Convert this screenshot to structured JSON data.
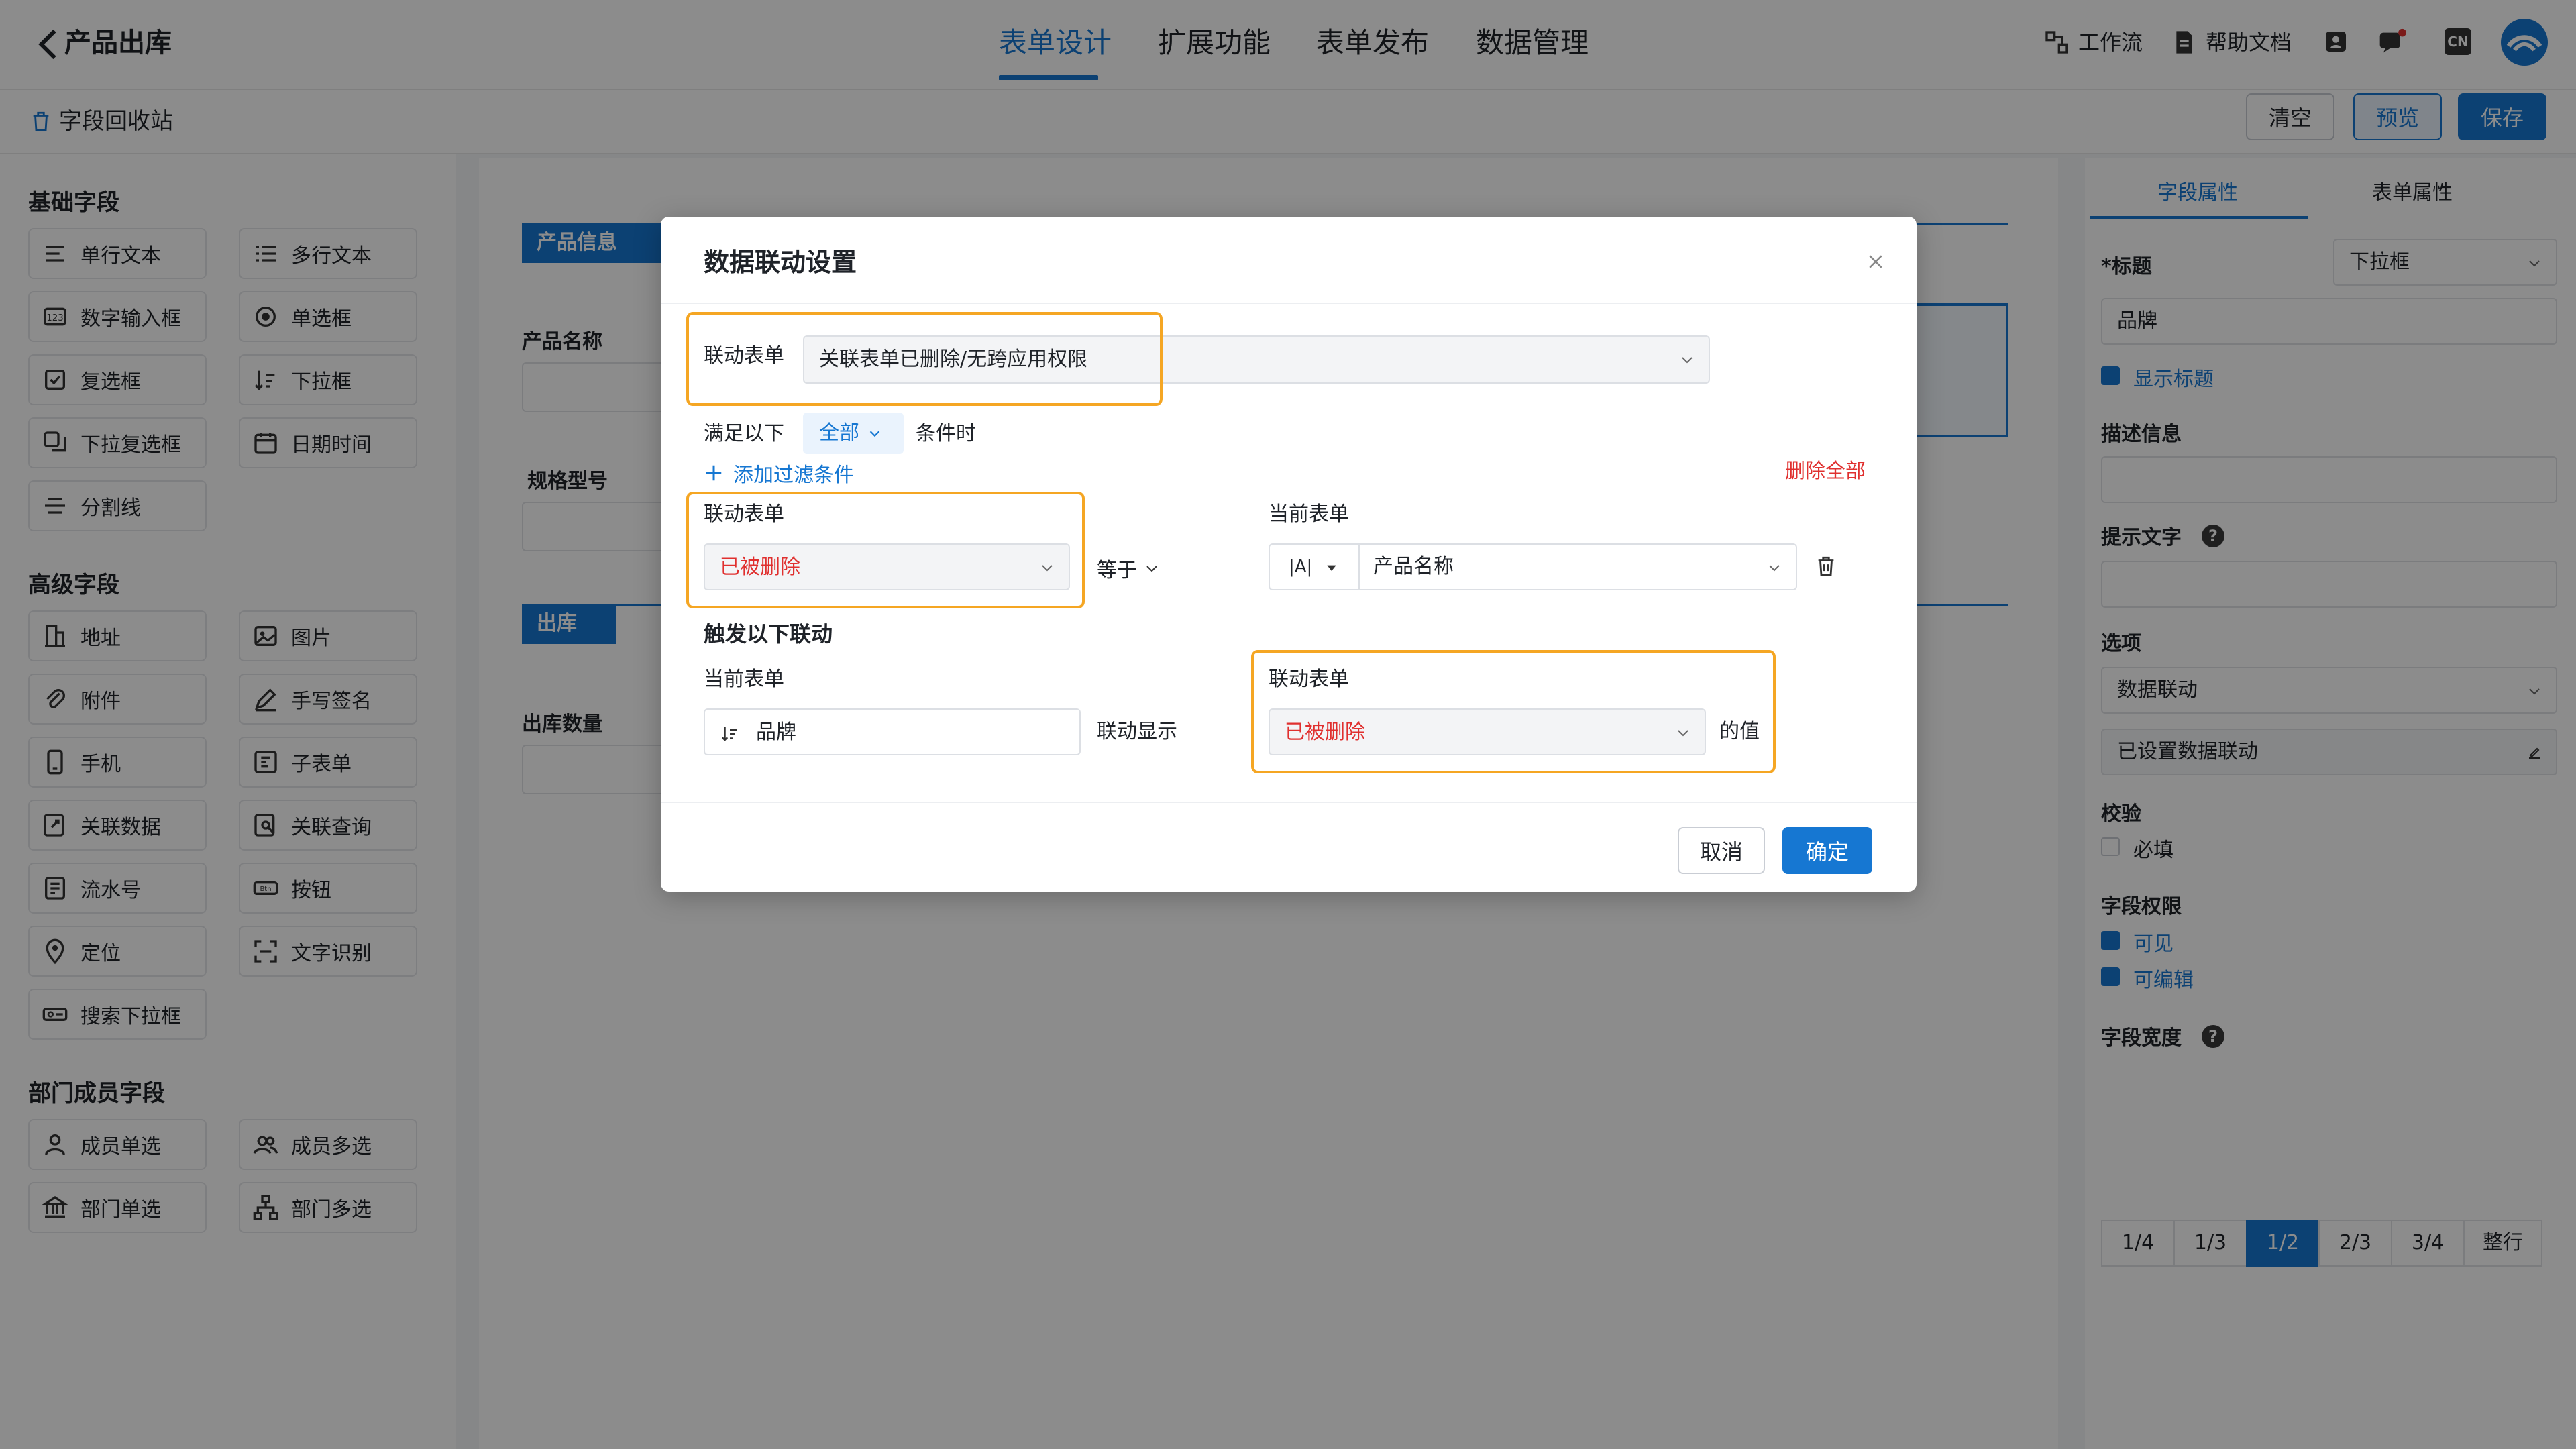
{
  "header": {
    "title": "产品出库",
    "tabs": [
      {
        "label": "表单设计",
        "active": true
      },
      {
        "label": "扩展功能",
        "active": false
      },
      {
        "label": "表单发布",
        "active": false
      },
      {
        "label": "数据管理",
        "active": false
      }
    ],
    "links": {
      "workflow": "工作流",
      "help": "帮助文档"
    },
    "lang_badge": "CN"
  },
  "subbar": {
    "recycle_label": "字段回收站",
    "buttons": {
      "clear": "清空",
      "preview": "预览",
      "save": "保存"
    }
  },
  "palette": {
    "groups": [
      {
        "title": "基础字段",
        "items": [
          "单行文本",
          "多行文本",
          "数字输入框",
          "单选框",
          "复选框",
          "下拉框",
          "下拉复选框",
          "日期时间",
          "分割线"
        ]
      },
      {
        "title": "高级字段",
        "items": [
          "地址",
          "图片",
          "附件",
          "手写签名",
          "手机",
          "子表单",
          "关联数据",
          "关联查询",
          "流水号",
          "按钮",
          "定位",
          "文字识别",
          "搜索下拉框"
        ]
      },
      {
        "title": "部门成员字段",
        "items": [
          "成员单选",
          "成员多选",
          "部门单选",
          "部门多选"
        ]
      }
    ]
  },
  "canvas": {
    "section1": "产品信息",
    "field_product_name": "产品名称",
    "field_spec": "规格型号",
    "section2": "出库",
    "field_qty": "出库数量"
  },
  "props": {
    "tabs": [
      "字段属性",
      "表单属性"
    ],
    "title_label": "*标题",
    "type_value": "下拉框",
    "title_value": "品牌",
    "show_title": "显示标题",
    "desc_label": "描述信息",
    "hint_label": "提示文字",
    "options_label": "选项",
    "options_value": "数据联动",
    "linkage_set": "已设置数据联动",
    "validate_label": "校验",
    "required": "必填",
    "perm_label": "字段权限",
    "visible": "可见",
    "editable": "可编辑",
    "width_label": "字段宽度",
    "widths": [
      "1/4",
      "1/3",
      "1/2",
      "2/3",
      "3/4",
      "整行"
    ],
    "width_selected": "1/2"
  },
  "dialog": {
    "title": "数据联动设置",
    "linked_form_label": "联动表单",
    "linked_form_value": "关联表单已删除/无跨应用权限",
    "condition_prefix": "满足以下",
    "condition_mode": "全部",
    "condition_suffix": "条件时",
    "add_filter": "添加过滤条件",
    "delete_all": "删除全部",
    "filter": {
      "left_label": "联动表单",
      "left_value": "已被删除",
      "operator": "等于",
      "right_label": "当前表单",
      "right_type": "|A|",
      "right_value": "产品名称"
    },
    "trigger_title": "触发以下联动",
    "trigger": {
      "current_label": "当前表单",
      "current_value": "品牌",
      "middle_text": "联动显示",
      "linked_label": "联动表单",
      "linked_value": "已被删除",
      "suffix": "的值"
    },
    "cancel": "取消",
    "confirm": "确定"
  },
  "colors": {
    "accent": "#1677d2",
    "highlight": "#f5a623",
    "danger": "#e0302f"
  }
}
